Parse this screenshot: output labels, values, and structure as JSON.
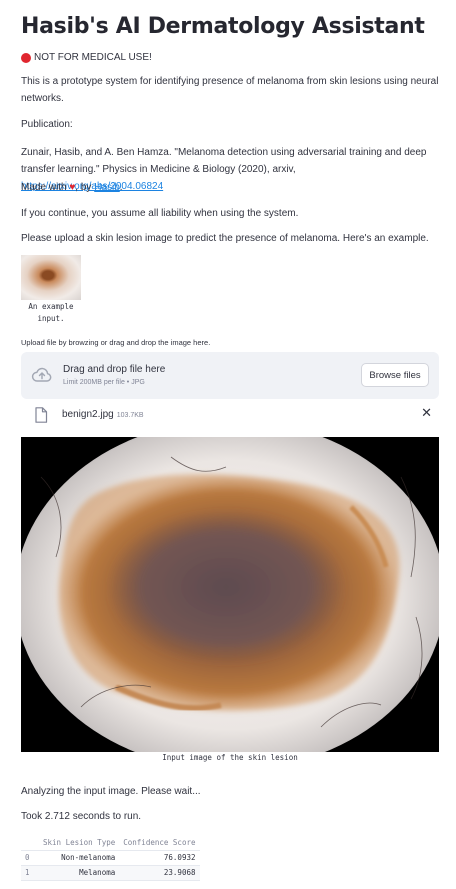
{
  "header": {
    "title": "Hasib's AI Dermatology Assistant",
    "warning": "NOT FOR MEDICAL USE!"
  },
  "intro": {
    "description": "This is a prototype system for identifying presence of melanoma from skin lesions using neural networks.",
    "publication_label": "Publication:",
    "citation": "Zunair, Hasib, and A. Ben Hamza. \"Melanoma detection using adversarial training and deep transfer learning.\" Physics in Medicine & Biology (2020), arxiv,",
    "citation_link": "https://arxiv.org/abs/2004.06824",
    "made_with_prefix": "Made with",
    "made_with_by": ", by",
    "author_link": "Hasib",
    "made_with_suffix": ".",
    "liability": "If you continue, you assume all liability when using the system.",
    "upload_prompt": "Please upload a skin lesion image to predict the presence of melanoma. Here's an example."
  },
  "example": {
    "caption_line1": "An example",
    "caption_line2": "input."
  },
  "uploader": {
    "label": "Upload file by browzing or drag and drop the image here.",
    "drop_text": "Drag and drop file here",
    "limit_text": "Limit 200MB per file • JPG",
    "browse_label": "Browse files",
    "file_name": "benign2.jpg",
    "file_size": "103.7KB",
    "close_glyph": "✕"
  },
  "result_image": {
    "caption": "Input image of the skin lesion"
  },
  "status": {
    "analyzing": "Analyzing the input image. Please wait...",
    "took": "Took 2.712 seconds to run."
  },
  "results_table": {
    "headers": [
      "",
      "Skin Lesion Type",
      "Confidence Score"
    ],
    "rows": [
      {
        "index": "0",
        "type": "Non-melanoma",
        "score": "76.0932"
      },
      {
        "index": "1",
        "type": "Melanoma",
        "score": "23.9068"
      }
    ]
  },
  "colors": {
    "link": "#1c83e1",
    "warning_dot": "#e0262f",
    "heart": "#e0262f",
    "dropzone_bg": "#f0f2f6"
  },
  "icons": {
    "warning": "red-circle-icon",
    "heart": "heart-icon",
    "upload": "cloud-upload-icon",
    "file": "file-icon",
    "close": "close-icon"
  }
}
